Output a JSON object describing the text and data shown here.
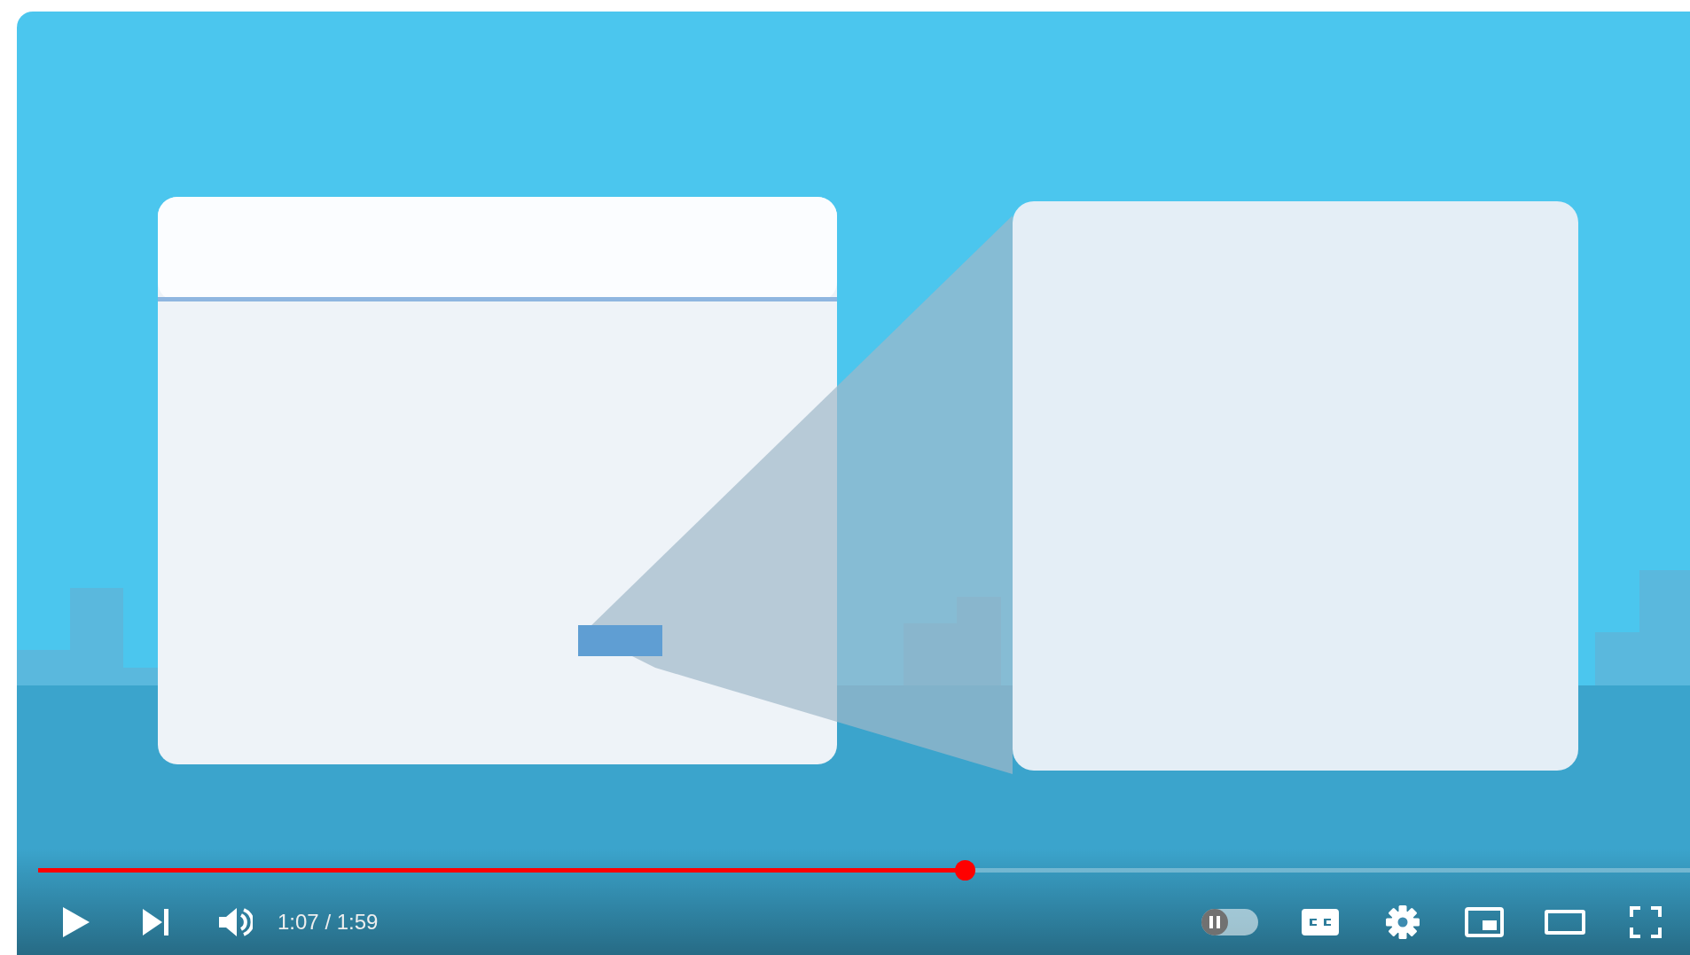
{
  "player": {
    "progress": {
      "level": 0.561
    },
    "time": "1:07 / 1:59",
    "autoplay": {
      "on": false
    },
    "captions": {
      "on": false
    }
  }
}
